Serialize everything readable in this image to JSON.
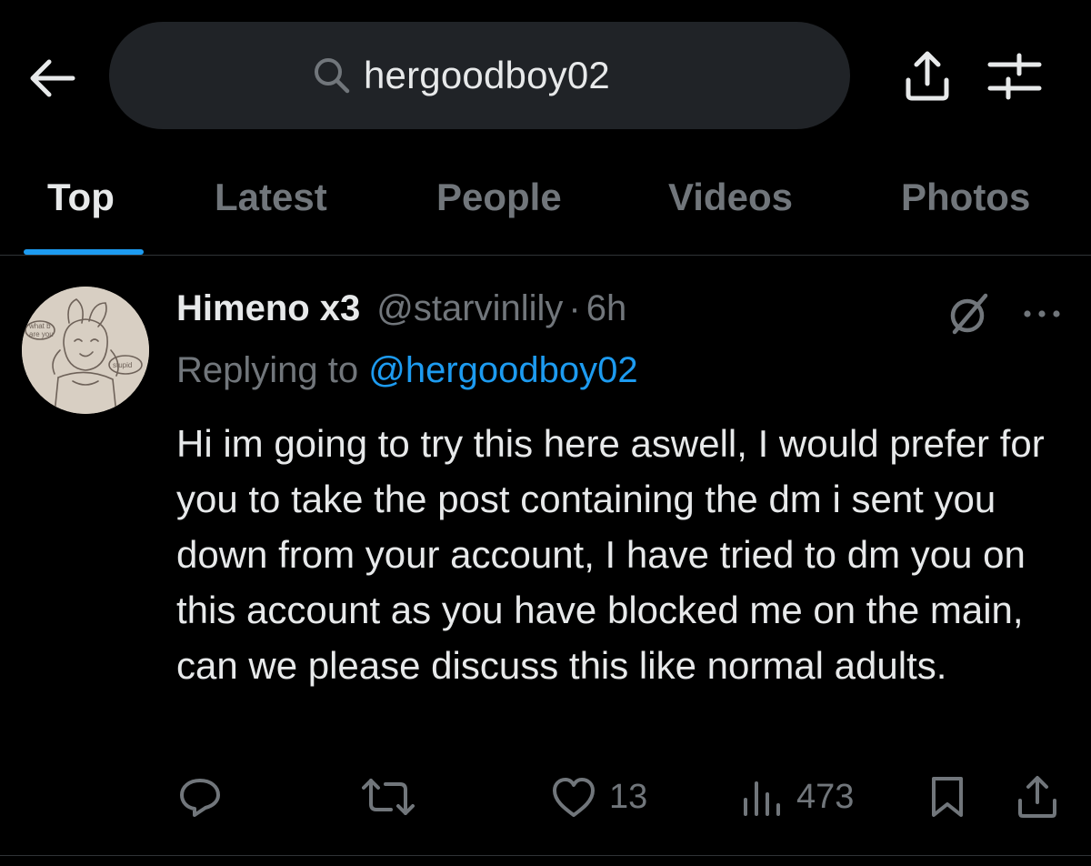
{
  "header": {
    "search": {
      "value": "hergoodboy02",
      "placeholder": "Search"
    }
  },
  "tabs": [
    {
      "label": "Top",
      "active": true
    },
    {
      "label": "Latest",
      "active": false
    },
    {
      "label": "People",
      "active": false
    },
    {
      "label": "Videos",
      "active": false
    },
    {
      "label": "Photos",
      "active": false
    }
  ],
  "tweet": {
    "display_name": "Himeno x3",
    "handle": "@starvinlily",
    "separator": "·",
    "time": "6h",
    "replying_prefix": "Replying to",
    "replying_handle": "@hergoodboy02",
    "body": "Hi im going to try this here aswell, I would prefer for you to take the post containing the dm i sent you down from your account, I have tried to dm you on this account as you have blocked me on the main, can we please discuss this like normal adults.",
    "avatar_text": [
      "what b",
      "are you",
      "stupid"
    ],
    "stats": {
      "likes": "13",
      "views": "473"
    }
  },
  "icons": {
    "back": "arrow-left-icon",
    "search": "search-icon",
    "share": "share-icon",
    "filter": "sliders-icon",
    "grok": "grok-icon",
    "more": "more-icon",
    "reply": "reply-icon",
    "retweet": "retweet-icon",
    "like": "heart-icon",
    "views": "views-icon",
    "bookmark": "bookmark-icon"
  },
  "colors": {
    "accent": "#1d9bf0",
    "muted": "#71767b",
    "text": "#e7e9ea",
    "background": "#000000",
    "search_bg": "#202327"
  }
}
